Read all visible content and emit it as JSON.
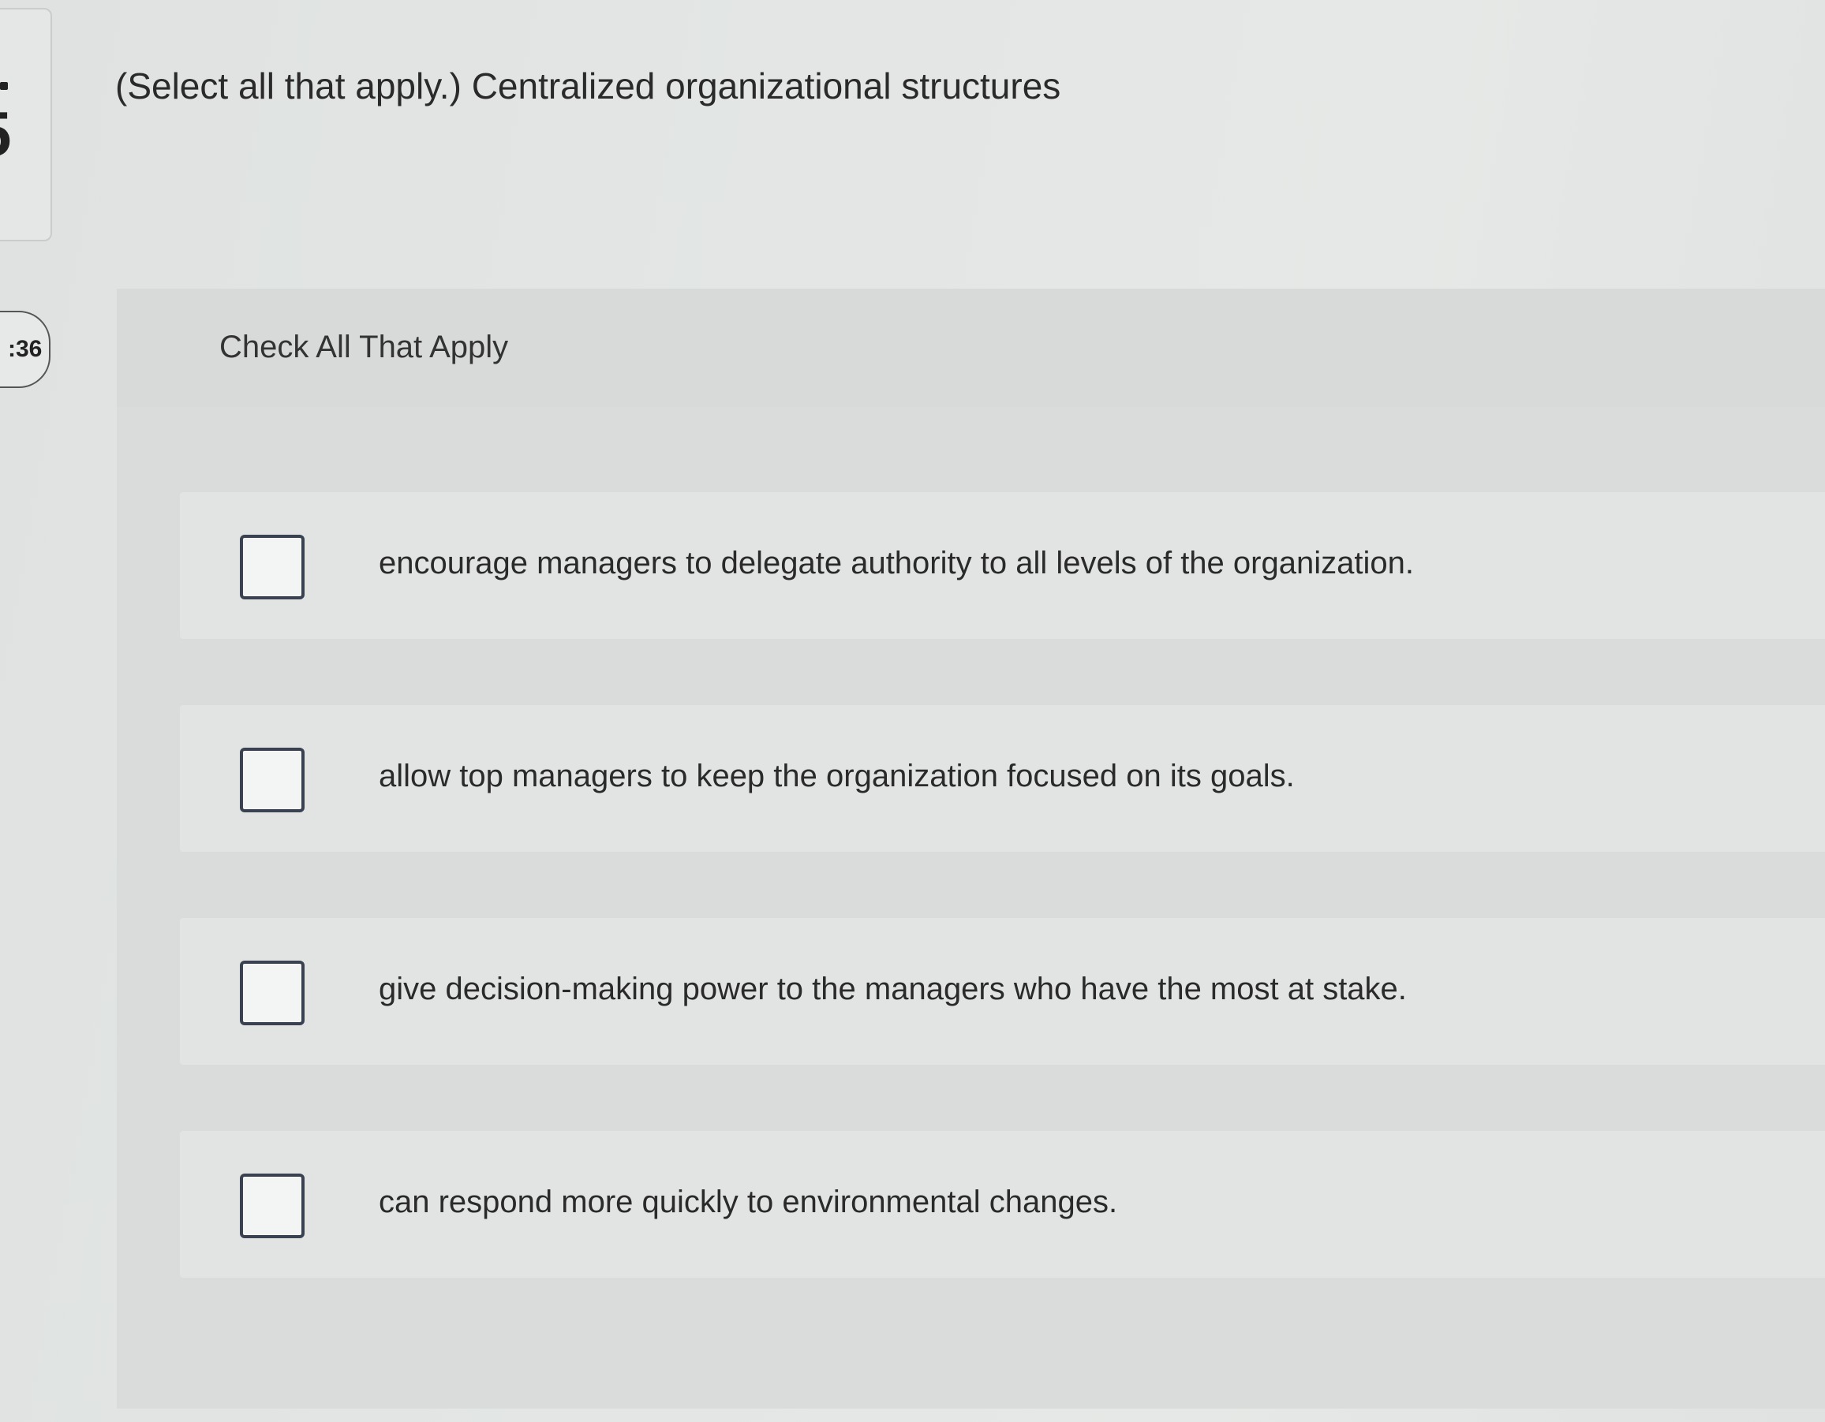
{
  "sidebar": {
    "timer_text": ":36"
  },
  "question": {
    "prompt": "(Select all that apply.) Centralized organizational structures"
  },
  "card": {
    "title": "Check All That Apply",
    "options": [
      {
        "label": "encourage managers to delegate authority to all levels of the organization.",
        "checked": false
      },
      {
        "label": "allow top managers to keep the organization focused on its goals.",
        "checked": false
      },
      {
        "label": "give decision-making power to the managers who have the most at stake.",
        "checked": false
      },
      {
        "label": "can respond more quickly to environmental changes.",
        "checked": false
      }
    ]
  }
}
